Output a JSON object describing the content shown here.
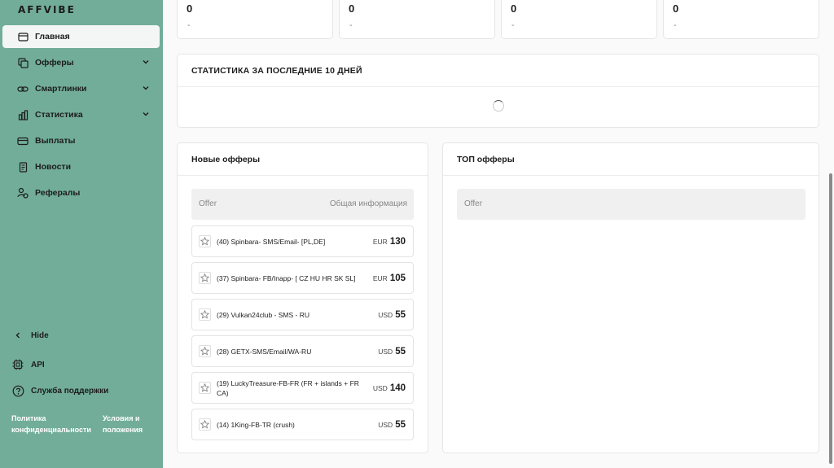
{
  "app": {
    "logo": "AFFVIBE"
  },
  "sidebar": {
    "items": [
      {
        "label": "Главная",
        "icon": "window-icon",
        "active": true,
        "has_chevron": false
      },
      {
        "label": "Офферы",
        "icon": "stack-icon",
        "active": false,
        "has_chevron": true
      },
      {
        "label": "Смартлинки",
        "icon": "link-icon",
        "active": false,
        "has_chevron": true
      },
      {
        "label": "Статистика",
        "icon": "bar-chart-icon",
        "active": false,
        "has_chevron": true
      },
      {
        "label": "Выплаты",
        "icon": "card-icon",
        "active": false,
        "has_chevron": false
      },
      {
        "label": "Новости",
        "icon": "news-icon",
        "active": false,
        "has_chevron": false
      },
      {
        "label": "Рефералы",
        "icon": "referral-icon",
        "active": false,
        "has_chevron": false
      }
    ],
    "hide_label": "Hide",
    "api_label": "API",
    "support_label": "Служба поддержки",
    "privacy_line1": "Политика",
    "privacy_line2": "конфиденциальности",
    "terms_line1": "Условия и",
    "terms_line2": "положения"
  },
  "stats": [
    {
      "value": "0",
      "sub": "-"
    },
    {
      "value": "0",
      "sub": "-"
    },
    {
      "value": "0",
      "sub": "-"
    },
    {
      "value": "0",
      "sub": "-"
    }
  ],
  "stats_panel": {
    "title": "СТАТИСТИКА ЗА ПОСЛЕДНИЕ 10 ДНЕЙ"
  },
  "new_offers": {
    "title": "Новые офферы",
    "col_offer": "Offer",
    "col_info": "Общая информация",
    "rows": [
      {
        "name": "(40) Spinbara- SMS/Email- [PL,DE]",
        "currency": "EUR",
        "amount": "130"
      },
      {
        "name": "(37) Spinbara- FB/Inapp- [ CZ HU HR SK SL]",
        "currency": "EUR",
        "amount": "105"
      },
      {
        "name": "(29) Vulkan24club - SMS - RU",
        "currency": "USD",
        "amount": "55"
      },
      {
        "name": "(28) GETX-SMS/Email/WA-RU",
        "currency": "USD",
        "amount": "55"
      },
      {
        "name": "(19) LuckyTreasure-FB-FR (FR + islands + FR CA)",
        "currency": "USD",
        "amount": "140"
      },
      {
        "name": "(14) 1King-FB-TR (crush)",
        "currency": "USD",
        "amount": "55"
      }
    ]
  },
  "top_offers": {
    "title": "ТОП офферы",
    "col_offer": "Offer"
  },
  "colors": {
    "sidebar_bg": "#72ad9a",
    "active_item_bg": "#f3f6f4",
    "card_bg": "#ffffff"
  }
}
